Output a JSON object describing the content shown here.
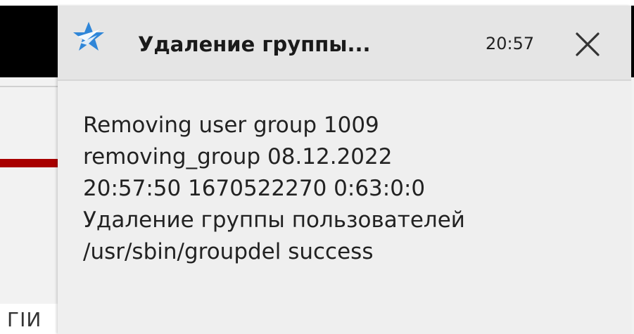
{
  "notification": {
    "app_icon": "app-star-icon",
    "title": "Удаление группы...",
    "time": "20:57",
    "close_icon": "close-icon",
    "body_lines": [
      "Removing user group 1009",
      "removing_group 08.12.2022",
      "20:57:50 1670522270 0:63:0:0",
      "Удаление группы пользователей",
      "/usr/sbin/groupdel success"
    ]
  },
  "background": {
    "fragment_text": "ГІИ"
  },
  "colors": {
    "popup_bg": "#efefef",
    "header_bg": "#e5e5e5",
    "icon_blue": "#2f86d8",
    "accent_red": "#a80000"
  }
}
